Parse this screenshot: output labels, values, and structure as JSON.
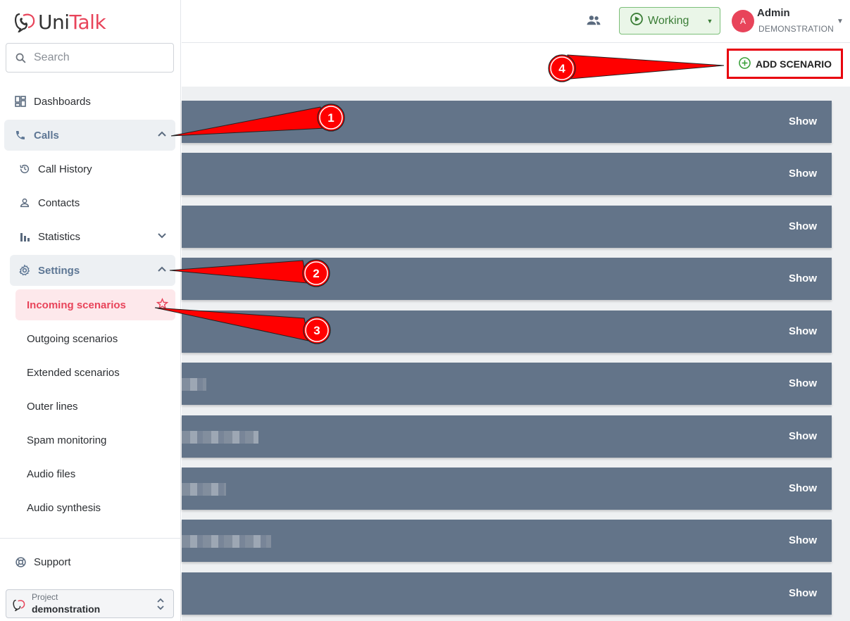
{
  "app": {
    "logo_prefix": "Uni",
    "logo_brand": "Talk"
  },
  "search": {
    "placeholder": "Search"
  },
  "sidebar": {
    "items": [
      {
        "label": "Dashboards",
        "icon": "dashboard-icon"
      },
      {
        "label": "Calls",
        "icon": "phone-icon",
        "expanded": true
      },
      {
        "label": "Call History",
        "icon": "history-icon"
      },
      {
        "label": "Contacts",
        "icon": "person-icon"
      },
      {
        "label": "Statistics",
        "icon": "bar-chart-icon",
        "expanded": false
      },
      {
        "label": "Settings",
        "icon": "gear-icon",
        "expanded": true
      },
      {
        "label": "Incoming scenarios",
        "active": true
      },
      {
        "label": "Outgoing scenarios"
      },
      {
        "label": "Extended scenarios"
      },
      {
        "label": "Outer lines"
      },
      {
        "label": "Spam monitoring"
      },
      {
        "label": "Audio files"
      },
      {
        "label": "Audio synthesis"
      }
    ],
    "support": "Support",
    "project_label": "Project",
    "project_name": "demonstration"
  },
  "header": {
    "status": "Working",
    "user_initial": "A",
    "user_name": "Admin",
    "user_role": "DEMONSTRATION"
  },
  "toolbar": {
    "add_label": "ADD SCENARIO"
  },
  "scenarios": [
    {
      "action": "Show"
    },
    {
      "action": "Show"
    },
    {
      "action": "Show"
    },
    {
      "action": "Show"
    },
    {
      "action": "Show"
    },
    {
      "action": "Show"
    },
    {
      "action": "Show"
    },
    {
      "action": "Show"
    },
    {
      "action": "Show"
    },
    {
      "action": "Show"
    }
  ],
  "callouts": [
    "1",
    "2",
    "3",
    "4"
  ],
  "colors": {
    "brand": "#e8445a",
    "row": "#637489",
    "status_green": "#3a7d36",
    "callout_red": "#ff0000"
  }
}
